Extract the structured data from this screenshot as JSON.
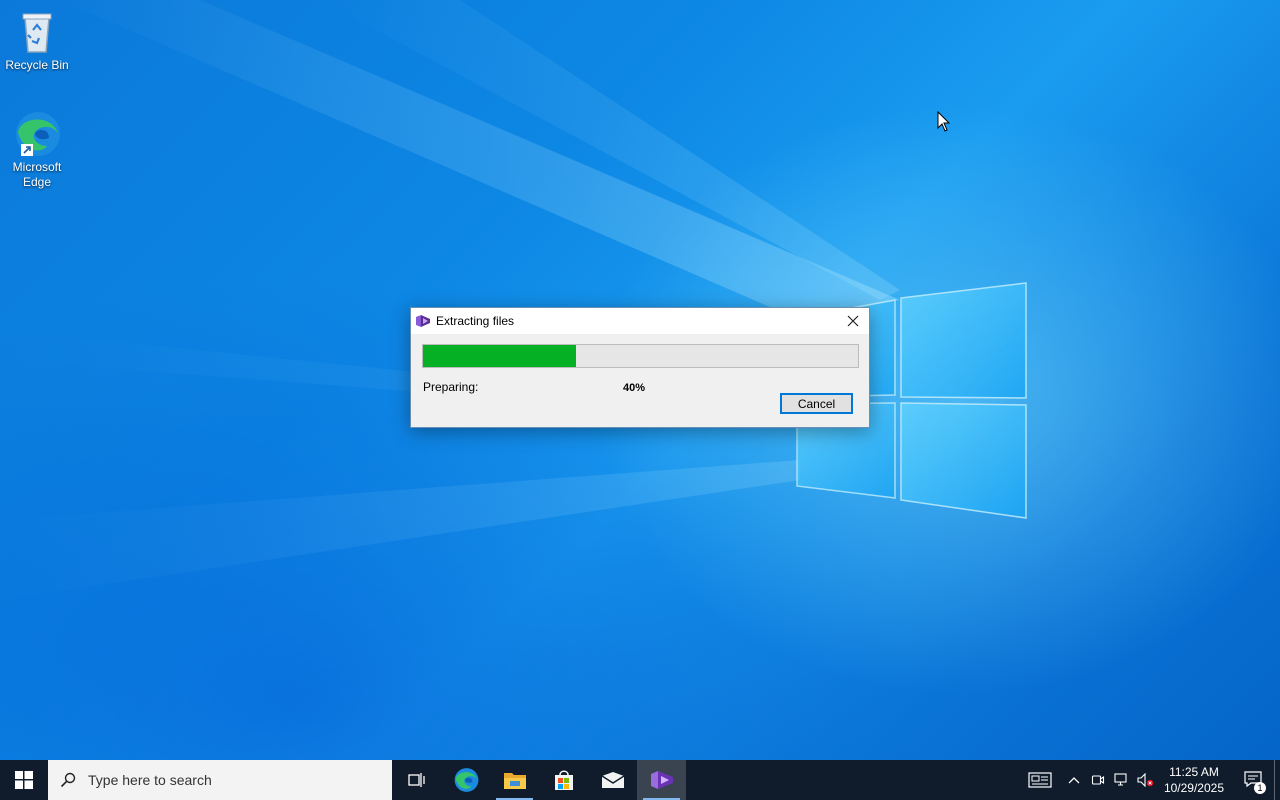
{
  "desktop": {
    "icons": [
      {
        "label": "Recycle Bin",
        "icon": "recycle-bin-icon"
      },
      {
        "label": "Microsoft Edge",
        "icon": "edge-icon"
      }
    ]
  },
  "dialog": {
    "title": "Extracting files",
    "app_icon": "visual-studio-installer-icon",
    "status_label": "Preparing:",
    "progress_percent": 40,
    "progress_text": "40%",
    "progress_color": "#06b025",
    "cancel_label": "Cancel"
  },
  "taskbar": {
    "search_placeholder": "Type here to search",
    "pinned": [
      {
        "name": "task-view",
        "icon": "task-view-icon"
      },
      {
        "name": "edge",
        "icon": "edge-icon"
      },
      {
        "name": "file-explorer",
        "icon": "folder-icon"
      },
      {
        "name": "microsoft-store",
        "icon": "store-icon"
      },
      {
        "name": "mail",
        "icon": "mail-icon"
      },
      {
        "name": "visual-studio-installer",
        "icon": "visual-studio-installer-icon"
      }
    ],
    "clock": {
      "time": "11:25 AM",
      "date": "10/29/2025"
    },
    "notification_count": "1"
  }
}
